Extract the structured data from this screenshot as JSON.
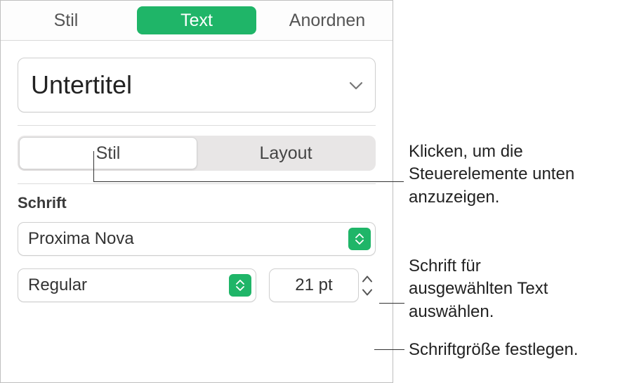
{
  "top_tabs": {
    "stil": "Stil",
    "text": "Text",
    "anordnen": "Anordnen"
  },
  "style_picker": {
    "value": "Untertitel"
  },
  "subtabs": {
    "stil": "Stil",
    "layout": "Layout"
  },
  "font_section": {
    "label": "Schrift",
    "family": "Proxima Nova",
    "weight": "Regular",
    "size": "21 pt"
  },
  "callouts": {
    "subtab": "Klicken, um die Steuerelemente unten anzuzeigen.",
    "font": "Schrift für ausgewählten Text auswählen.",
    "size": "Schriftgröße festlegen."
  }
}
